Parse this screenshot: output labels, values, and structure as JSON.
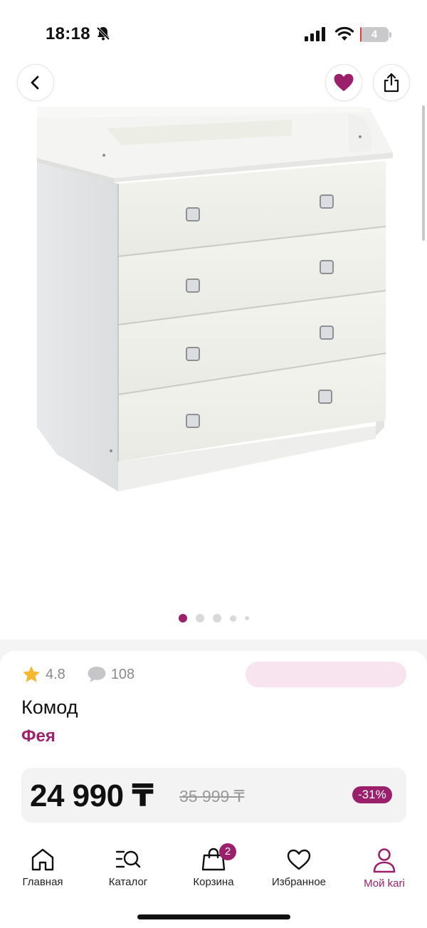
{
  "status_bar": {
    "time": "18:18",
    "battery": "4",
    "battery_level_percent": 4,
    "battery_color": "#e0413f"
  },
  "header": {
    "back_icon": "chevron-left-icon",
    "favorite_icon": "heart-filled-icon",
    "share_icon": "share-icon"
  },
  "gallery": {
    "image": "white-changing-dresser-4-drawers",
    "page_count": 5,
    "active_page": 1
  },
  "product": {
    "rating": "4.8",
    "reviews": "108",
    "title": "Комод",
    "brand": "Фея",
    "price": "24 990 ₸",
    "old_price": "35 999 ₸",
    "discount": "-31%"
  },
  "tabs": [
    {
      "label": "Главная",
      "icon": "home-icon",
      "active": false
    },
    {
      "label": "Каталог",
      "icon": "catalog-search-icon",
      "active": false
    },
    {
      "label": "Корзина",
      "icon": "shopping-bag-icon",
      "active": false,
      "badge": "2"
    },
    {
      "label": "Избранное",
      "icon": "heart-outline-icon",
      "active": false
    },
    {
      "label": "Мой kari",
      "icon": "profile-icon",
      "active": true
    }
  ],
  "colors": {
    "accent": "#9b1f6b",
    "brand_text": "#a0226d",
    "pill_pink": "#f8e4ee",
    "star": "#f5b82e"
  }
}
